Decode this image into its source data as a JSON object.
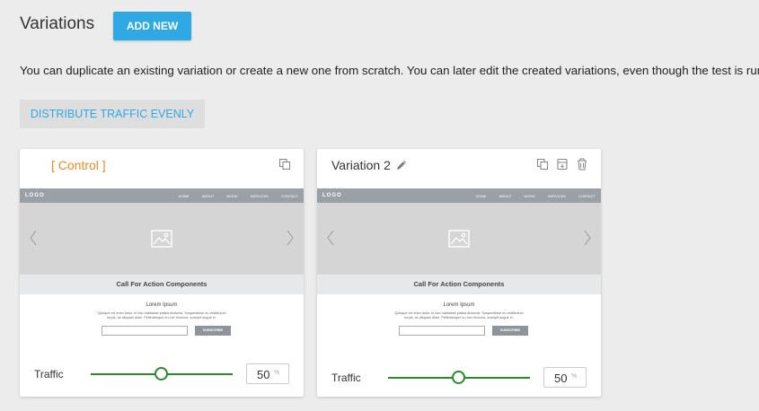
{
  "header": {
    "title": "Variations",
    "add_new_label": "ADD NEW"
  },
  "description": "You can duplicate an existing variation or create a new one from scratch. You can later edit the created variations, even though the test is running.",
  "distribute_label": "DISTRIBUTE TRAFFIC EVENLY",
  "colors": {
    "accent": "#2ea9e3",
    "control_label": "#ef8b1c",
    "slider": "#2a8a2a"
  },
  "preview": {
    "logo": "LOGO",
    "menu": [
      "HOME",
      "ABOUT",
      "WORK",
      "SERVICES",
      "CONTACT"
    ],
    "cta_title": "Call For Action Components",
    "lorem_title": "Lorem Ipsum",
    "lorem_line1": "Quisque vel enim dolor. In hac habitasse platea dictumst. Suspendisse eu vestibulum",
    "lorem_line2": "turpis, ac aliquam diam. Pellentesque eu orci rhoncus, suscipit augue in.",
    "subscribe_label": "SUBSCRIBE"
  },
  "variations": [
    {
      "name": "[ Control ]",
      "traffic_label": "Traffic",
      "traffic_value": "50",
      "traffic_unit": "%",
      "traffic_fraction": 0.5,
      "icons": [
        "duplicate-icon"
      ]
    },
    {
      "name": "Variation 2",
      "traffic_label": "Traffic",
      "traffic_value": "50",
      "traffic_unit": "%",
      "traffic_fraction": 0.5,
      "icons": [
        "edit-icon",
        "duplicate-icon",
        "archive-icon",
        "trash-icon"
      ]
    }
  ]
}
